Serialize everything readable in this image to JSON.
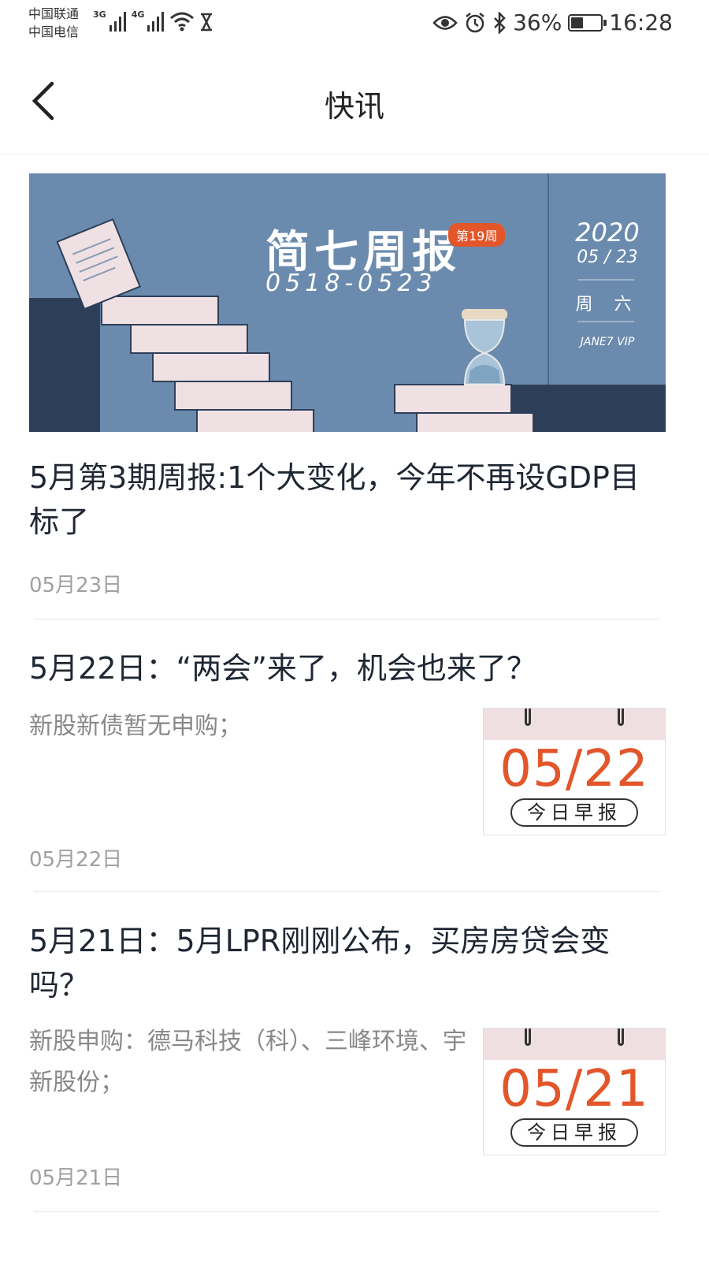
{
  "status_bar": {
    "carrier_1": "中国联通",
    "carrier_2": "中国电信",
    "net_1": "3G",
    "net_2": "4G",
    "battery": "36%",
    "battery_level": 0.36,
    "time": "16:28"
  },
  "nav": {
    "title": "快讯"
  },
  "banner": {
    "title": "简七周报",
    "week": "第19周",
    "range": "0518-0523",
    "year": "2020",
    "month_day": "05 / 23",
    "weekday": "周 六",
    "brand": "JANE7 VIP"
  },
  "articles": [
    {
      "title": "5月第3期周报:1个大变化，今年不再设GDP目标了",
      "date": "05月23日"
    },
    {
      "title": "5月22日：“两会”来了，机会也来了？",
      "summary": "新股新债暂无申购；",
      "thumb_date": "05/22",
      "thumb_label": "今日早报",
      "date": "05月22日"
    },
    {
      "title": "5月21日：5月LPR刚刚公布，买房房贷会变吗？",
      "summary": "新股申购：德马科技（科）、三峰环境、宇新股份；",
      "thumb_date": "05/21",
      "thumb_label": "今日早报",
      "date": "05月21日"
    }
  ],
  "colors": {
    "accent": "#e2562a",
    "banner_bg": "#6b8bae",
    "banner_dark": "#2d3f58",
    "stairs": "#efe1e3"
  }
}
